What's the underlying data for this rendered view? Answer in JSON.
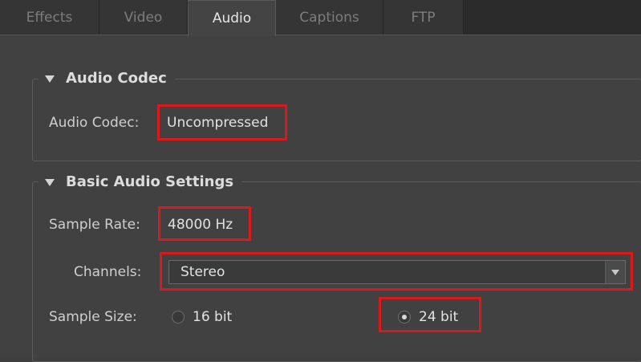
{
  "tabs": [
    {
      "label": "Effects",
      "active": false
    },
    {
      "label": "Video",
      "active": false
    },
    {
      "label": "Audio",
      "active": true
    },
    {
      "label": "Captions",
      "active": false
    },
    {
      "label": "FTP",
      "active": false
    }
  ],
  "audio_codec_group": {
    "title": "Audio Codec",
    "codec_label": "Audio Codec:",
    "codec_value": "Uncompressed"
  },
  "basic_audio_group": {
    "title": "Basic Audio Settings",
    "sample_rate_label": "Sample Rate:",
    "sample_rate_value": "48000 Hz",
    "channels_label": "Channels:",
    "channels_value": "Stereo",
    "sample_size_label": "Sample Size:",
    "sample_size_options": [
      {
        "label": "16 bit",
        "selected": false
      },
      {
        "label": "24 bit",
        "selected": true
      }
    ]
  },
  "colors": {
    "highlight": "#d81a1a",
    "background": "#414141"
  },
  "icons": {
    "collapse": "triangle-down-icon",
    "dropdown": "chevron-down-icon"
  }
}
